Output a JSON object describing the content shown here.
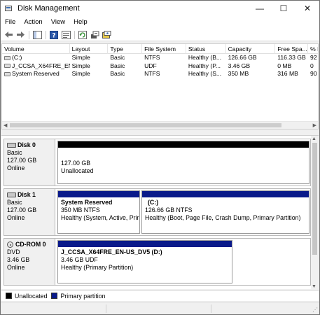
{
  "window": {
    "title": "Disk Management",
    "minimize": "—",
    "maximize": "☐",
    "close": "✕"
  },
  "menu": [
    "File",
    "Action",
    "View",
    "Help"
  ],
  "columns": [
    "Volume",
    "Layout",
    "Type",
    "File System",
    "Status",
    "Capacity",
    "Free Spa...",
    "% F"
  ],
  "volumes": [
    {
      "volume": "(C:)",
      "layout": "Simple",
      "type": "Basic",
      "fs": "NTFS",
      "status": "Healthy (B...",
      "capacity": "126.66 GB",
      "free": "116.33 GB",
      "pct": "92"
    },
    {
      "volume": "J_CCSA_X64FRE_EN...",
      "layout": "Simple",
      "type": "Basic",
      "fs": "UDF",
      "status": "Healthy (P...",
      "capacity": "3.46 GB",
      "free": "0 MB",
      "pct": "0"
    },
    {
      "volume": "System Reserved",
      "layout": "Simple",
      "type": "Basic",
      "fs": "NTFS",
      "status": "Healthy (S...",
      "capacity": "350 MB",
      "free": "316 MB",
      "pct": "90"
    }
  ],
  "disks": [
    {
      "name": "Disk 0",
      "kind": "Basic",
      "size": "127.00 GB",
      "state": "Online",
      "partitions": [
        {
          "name": "",
          "line1": "127.00 GB",
          "line2": "Unallocated"
        }
      ]
    },
    {
      "name": "Disk 1",
      "kind": "Basic",
      "size": "127.00 GB",
      "state": "Online",
      "partitions": [
        {
          "name": "System Reserved",
          "line1": "350 MB NTFS",
          "line2": "Healthy (System, Active, Prir"
        },
        {
          "name": "(C:)",
          "line1": "126.66 GB NTFS",
          "line2": "Healthy (Boot, Page File, Crash Dump, Primary Partition)"
        }
      ]
    },
    {
      "name": "CD-ROM 0",
      "kind": "DVD",
      "size": "3.46 GB",
      "state": "Online",
      "partitions": [
        {
          "name": "J_CCSA_X64FRE_EN-US_DV5  (D:)",
          "line1": "3.46 GB UDF",
          "line2": "Healthy (Primary Partition)"
        }
      ]
    }
  ],
  "legend": [
    {
      "label": "Unallocated",
      "color": "#000000"
    },
    {
      "label": "Primary partition",
      "color": "#0a1a8a"
    }
  ],
  "colors": {
    "unallocated": "#000000",
    "primary": "#0a1a8a"
  }
}
